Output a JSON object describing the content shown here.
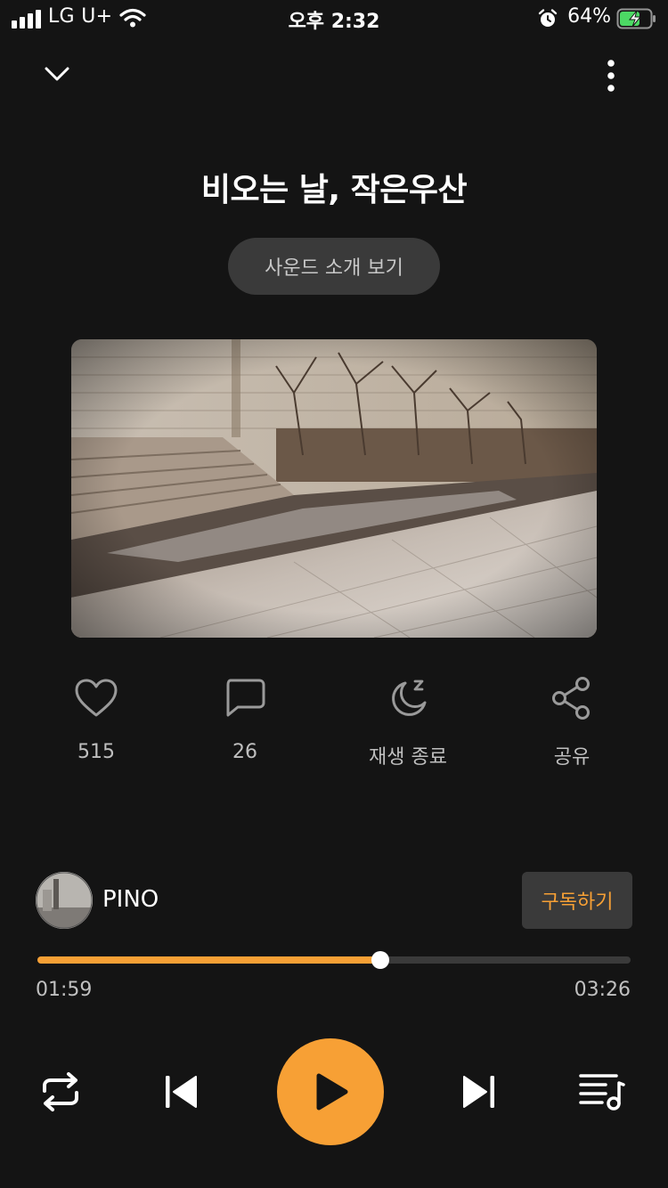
{
  "status_bar": {
    "carrier": "LG U+",
    "time": "오후 2:32",
    "battery": "64%"
  },
  "header": {
    "collapse_icon": "chevron-down-icon",
    "more_icon": "more-vertical-icon"
  },
  "track": {
    "title": "비오는 날, 작은우산",
    "intro_button_label": "사운드 소개 보기",
    "artwork_alt": "album artwork"
  },
  "actions": [
    {
      "icon": "heart-icon",
      "label": "515"
    },
    {
      "icon": "comment-icon",
      "label": "26"
    },
    {
      "icon": "sleep-timer-icon",
      "label": "재생 종료"
    },
    {
      "icon": "share-icon",
      "label": "공유"
    }
  ],
  "artist": {
    "name": "PINO",
    "subscribe_label": "구독하기"
  },
  "playback": {
    "current_time": "01:59",
    "total_time": "03:26",
    "progress": 0.578
  },
  "controls": {
    "repeat_icon": "repeat-icon",
    "prev_icon": "skip-previous-icon",
    "play_icon": "play-icon",
    "next_icon": "skip-next-icon",
    "playlist_icon": "playlist-icon"
  },
  "colors": {
    "accent": "#f7a035",
    "background": "#141414",
    "button_bg": "#3a3a3a"
  }
}
